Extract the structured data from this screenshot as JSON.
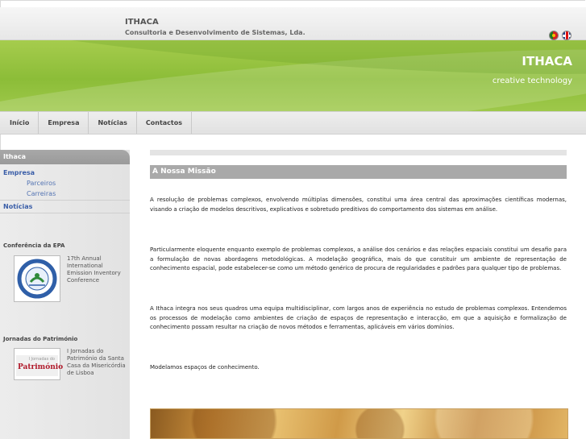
{
  "header": {
    "name": "ITHACA",
    "subtitle": "Consultoria e Desenvolvimento de Sistemas, Lda.",
    "languages": [
      "pt-flag-icon",
      "gb-flag-icon"
    ]
  },
  "banner": {
    "title": "ITHACA",
    "tagline": "creative technology",
    "color": "#8cbd38"
  },
  "nav": {
    "items": [
      "Início",
      "Empresa",
      "Notícias",
      "Contactos"
    ]
  },
  "sidebar": {
    "heading": "Ithaca",
    "links": {
      "empresa": "Empresa",
      "parceiros": "Parceiros",
      "carreiras": "Carreiras",
      "noticias": "Notícias"
    },
    "epa": {
      "title": "Conferência da EPA",
      "text": "17th Annual International Emission Inventory Conference",
      "image": "epa-seal-icon"
    },
    "patrimonio": {
      "title": "Jornadas do Património",
      "text": "I Jornadas do Património da Santa Casa da Misericórdia de Lisboa",
      "logo_small": "I Jornadas do",
      "logo_big": "Património"
    }
  },
  "main": {
    "section_title": "A Nossa Missão",
    "paragraphs": [
      "A resolução de problemas complexos, envolvendo múltiplas dimensões, constitui uma área central das aproximações científicas modernas, visando a criação de modelos descritivos, explicativos e sobretudo preditivos do comportamento dos sistemas em análise.",
      "Particularmente eloquente enquanto exemplo de problemas complexos, a análise dos cenários e das relações espaciais constitui um desafio para a formulação de novas abordagens metodológicas. A modelação geográfica, mais do que constituir um ambiente de representação de conhecimento espacial, pode estabelecer-se como um método genérico de procura de regularidades e padrões para qualquer tipo de problemas.",
      "A Ithaca integra nos seus quadros uma equipa multidisciplinar, com largos anos de experiência no estudo de problemas complexos. Entendemos os processos de modelação como ambientes de criação de espaços de representação e interacção, em que a aquisição e formalização de conhecimento possam resultar na criação de novos métodos e ferramentas, aplicáveis em vários domínios.",
      "Modelamos espaços de conhecimento."
    ],
    "image": "world-map-image"
  }
}
